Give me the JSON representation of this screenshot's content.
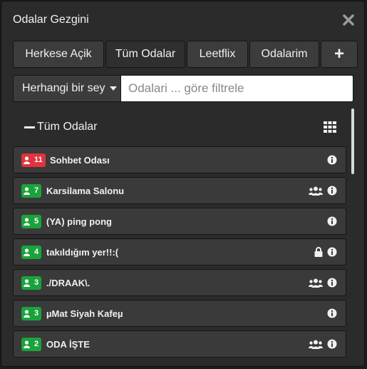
{
  "window": {
    "title": "Odalar Gezgini"
  },
  "tabs": [
    {
      "label": "Herkese Açik",
      "active": false
    },
    {
      "label": "Tüm Odalar",
      "active": true
    },
    {
      "label": "Leetflix",
      "active": false
    },
    {
      "label": "Odalarim",
      "active": false
    },
    {
      "label": "+",
      "active": false
    }
  ],
  "filter": {
    "dropdown_label": "Herhangi bir sey",
    "search_placeholder": "Odalari ... göre filtrele",
    "search_value": ""
  },
  "section": {
    "label": "Tüm Odalar"
  },
  "colors": {
    "red_badge": "#e0333f",
    "green_badge": "#1aa33b"
  },
  "rooms": [
    {
      "count": "11",
      "name": "Sohbet Odası",
      "badge_color": "red",
      "icons": [
        "info-icon"
      ]
    },
    {
      "count": "7",
      "name": "Karsilama Salonu",
      "badge_color": "green",
      "icons": [
        "users-icon",
        "info-icon"
      ]
    },
    {
      "count": "5",
      "name": "(YA) ping pong",
      "badge_color": "green",
      "icons": [
        "info-icon"
      ]
    },
    {
      "count": "4",
      "name": "takıldığım yer!!:(",
      "badge_color": "green",
      "icons": [
        "lock-icon",
        "info-icon"
      ]
    },
    {
      "count": "3",
      "name": "./DRAAK\\.",
      "badge_color": "green",
      "icons": [
        "users-icon",
        "info-icon"
      ]
    },
    {
      "count": "3",
      "name": "µMat Siyah Kafeµ",
      "badge_color": "green",
      "icons": [
        "info-icon"
      ]
    },
    {
      "count": "2",
      "name": "ODA İŞTE",
      "badge_color": "green",
      "icons": [
        "users-icon",
        "info-icon"
      ]
    }
  ]
}
